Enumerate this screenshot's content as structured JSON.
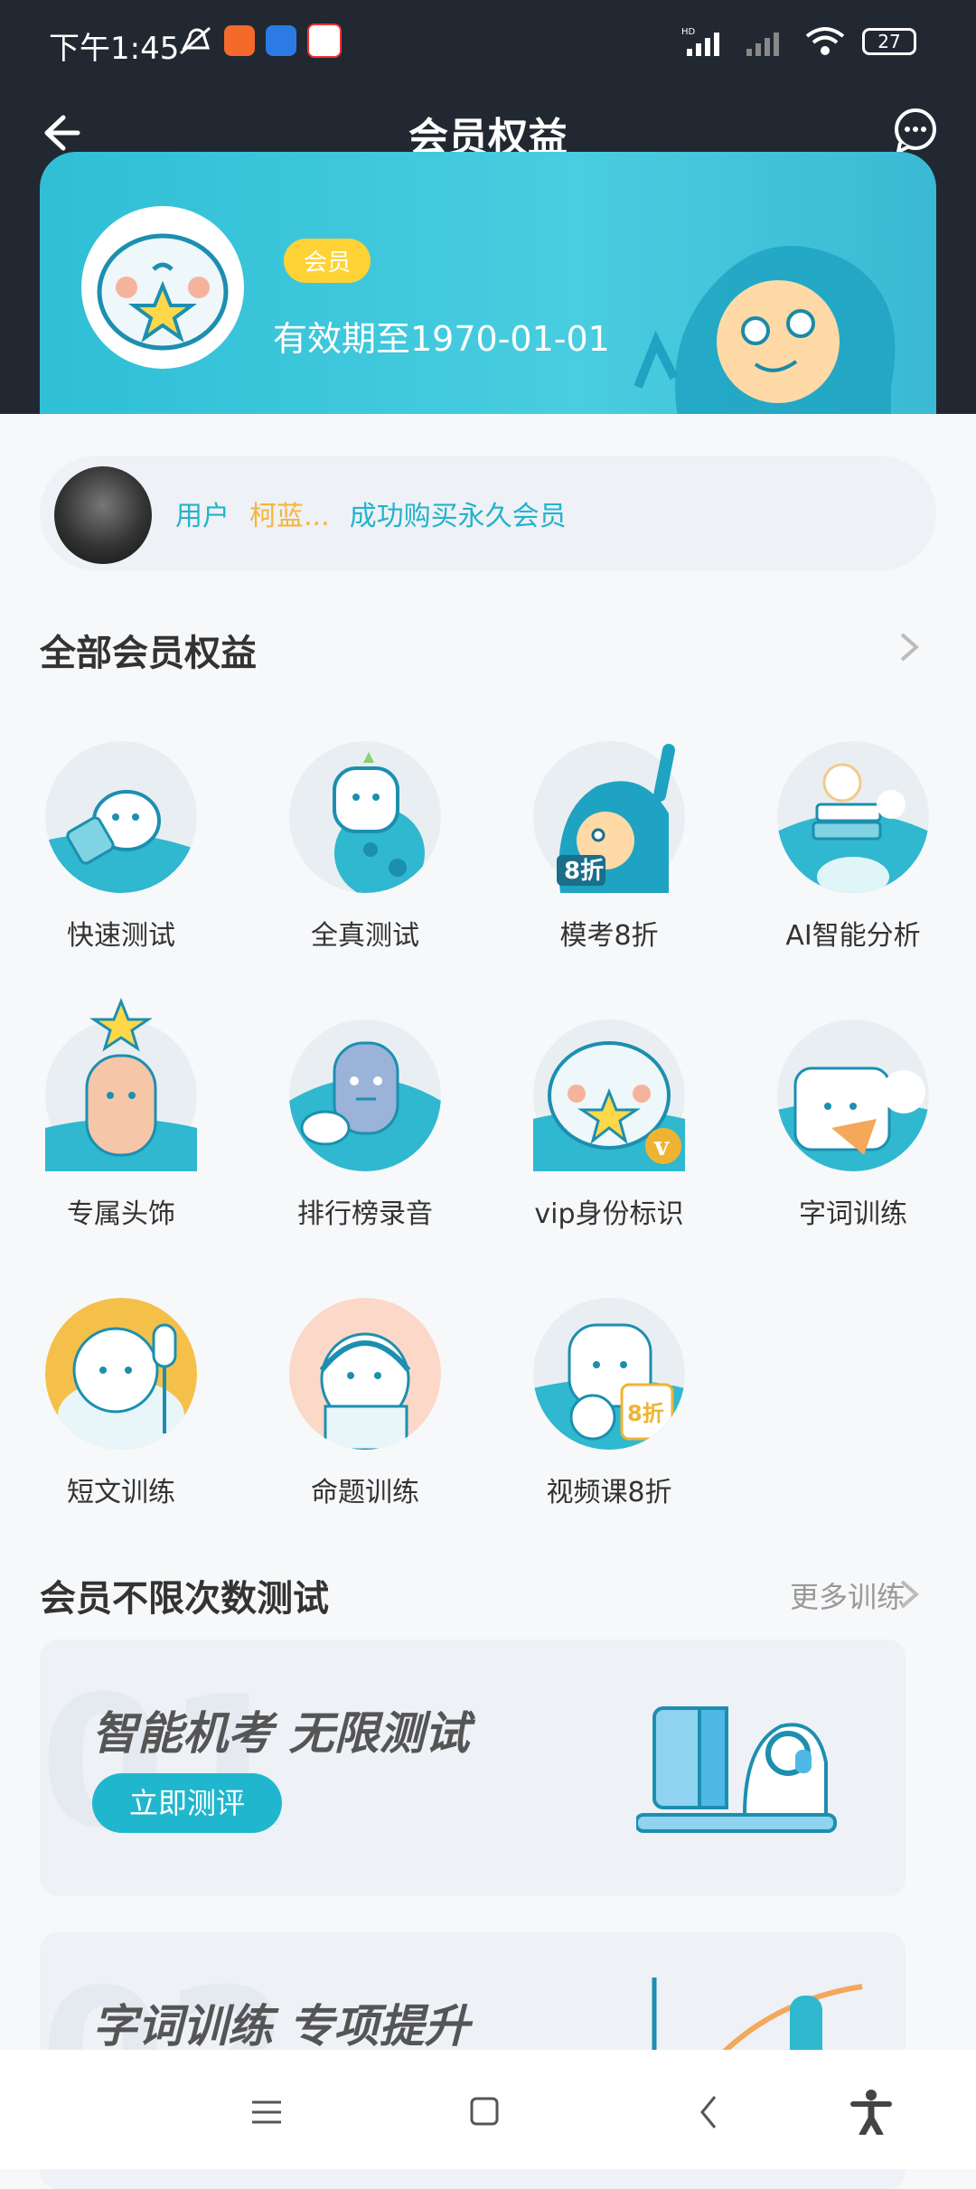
{
  "status_bar": {
    "time": "下午1:45",
    "battery": "27",
    "network": "HD"
  },
  "header": {
    "title": "会员权益"
  },
  "vip": {
    "badge": "会员",
    "expire": "有效期至1970-01-01"
  },
  "buyer": {
    "prefix": "用户",
    "name": "柯蓝...",
    "message": "成功购买永久会员"
  },
  "benefits_section": {
    "title": "全部会员权益"
  },
  "benefits": [
    {
      "label": "快速测试",
      "icon": "quick-test-icon"
    },
    {
      "label": "全真测试",
      "icon": "full-test-icon"
    },
    {
      "label": "模考8折",
      "icon": "mock-exam-discount-icon"
    },
    {
      "label": "AI智能分析",
      "icon": "ai-analysis-icon"
    },
    {
      "label": "专属头饰",
      "icon": "headwear-icon"
    },
    {
      "label": "排行榜录音",
      "icon": "ranking-recording-icon"
    },
    {
      "label": "vip身份标识",
      "icon": "vip-identity-icon"
    },
    {
      "label": "字词训练",
      "icon": "word-training-icon"
    },
    {
      "label": "短文训练",
      "icon": "passage-training-icon"
    },
    {
      "label": "命题训练",
      "icon": "topic-training-icon"
    },
    {
      "label": "视频课8折",
      "icon": "video-course-discount-icon"
    }
  ],
  "unlimited_section": {
    "title": "会员不限次数测试",
    "more": "更多训练"
  },
  "promos": [
    {
      "headline": "智能机考 无限测试",
      "button": "立即测评"
    },
    {
      "headline": "字词训练 专项提升"
    }
  ]
}
